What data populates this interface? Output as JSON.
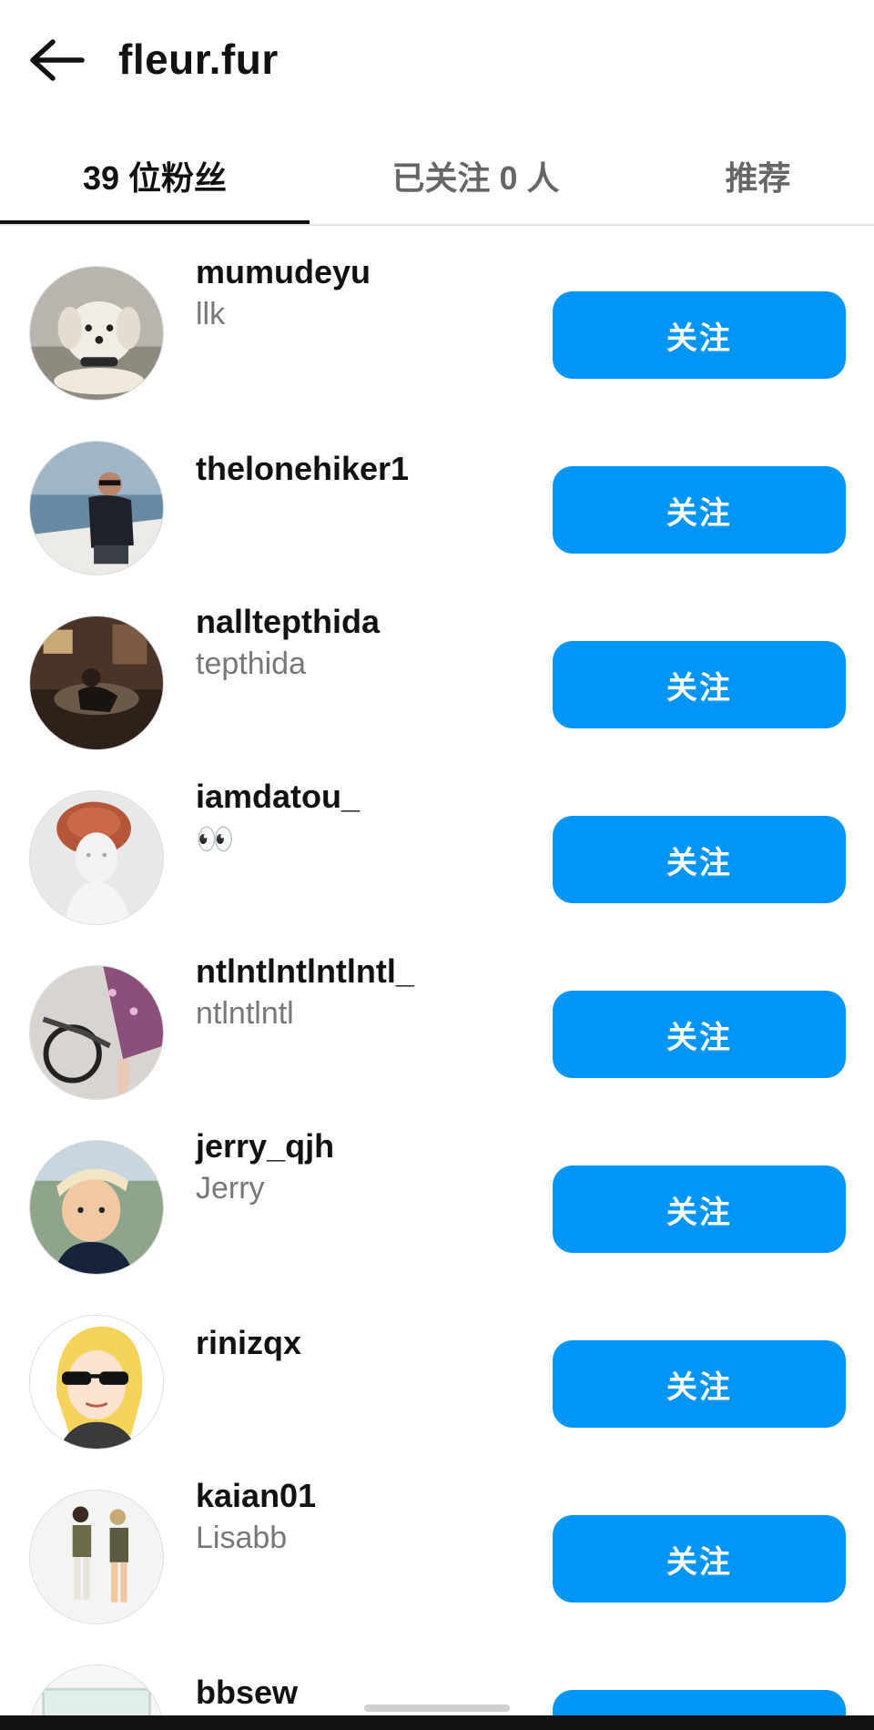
{
  "header": {
    "title": "fleur.fur",
    "back_icon": "arrow-left-icon"
  },
  "tabs": [
    {
      "label": "39 位粉丝",
      "active": true
    },
    {
      "label": "已关注 0 人",
      "active": false
    },
    {
      "label": "推荐",
      "active": false
    }
  ],
  "follow_label": "关注",
  "accent_color": "#0095f6",
  "users": [
    {
      "username": "mumudeyu",
      "fullname": "llk"
    },
    {
      "username": "thelonehiker1",
      "fullname": ""
    },
    {
      "username": "nalltepthida",
      "fullname": "tepthida"
    },
    {
      "username": "iamdatou_",
      "fullname": "👀"
    },
    {
      "username": "ntlntlntlntlntl_",
      "fullname": "ntlntlntl"
    },
    {
      "username": "jerry_qjh",
      "fullname": "Jerry"
    },
    {
      "username": "rinizqx",
      "fullname": ""
    },
    {
      "username": "kaian01",
      "fullname": "Lisabb"
    },
    {
      "username": "bbsew",
      "fullname": ""
    }
  ]
}
